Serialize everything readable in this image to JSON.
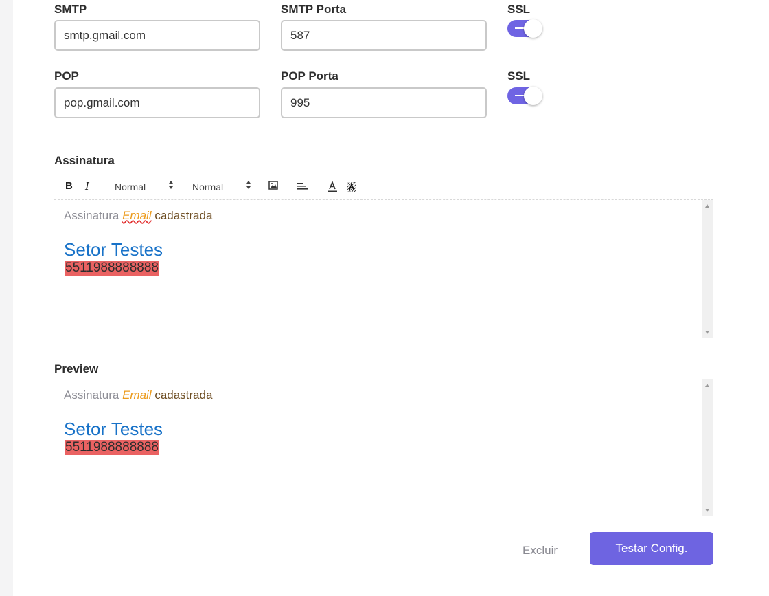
{
  "smtp": {
    "label": "SMTP",
    "value": "smtp.gmail.com",
    "port_label": "SMTP Porta",
    "port_value": "587",
    "ssl_label": "SSL",
    "ssl_on": true
  },
  "pop": {
    "label": "POP",
    "value": "pop.gmail.com",
    "port_label": "POP Porta",
    "port_value": "995",
    "ssl_label": "SSL",
    "ssl_on": true
  },
  "signature": {
    "label": "Assinatura",
    "toolbar": {
      "bold": "B",
      "italic": "I",
      "font_select": "Normal",
      "size_select": "Normal"
    },
    "content": {
      "word1": "Assinatura",
      "word2": "Email",
      "word3": "cadastrada",
      "title": "Setor Testes",
      "phone": "5511988888888"
    }
  },
  "preview": {
    "label": "Preview",
    "content": {
      "word1": "Assinatura",
      "word2": "Email",
      "word3": "cadastrada",
      "title": "Setor Testes",
      "phone": "5511988888888"
    }
  },
  "actions": {
    "delete": "Excluir",
    "test": "Testar Config."
  },
  "colors": {
    "accent": "#6e64e1",
    "phone_highlight": "#ea6262",
    "title_blue": "#1872c8",
    "email_orange": "#ec9b1c"
  }
}
